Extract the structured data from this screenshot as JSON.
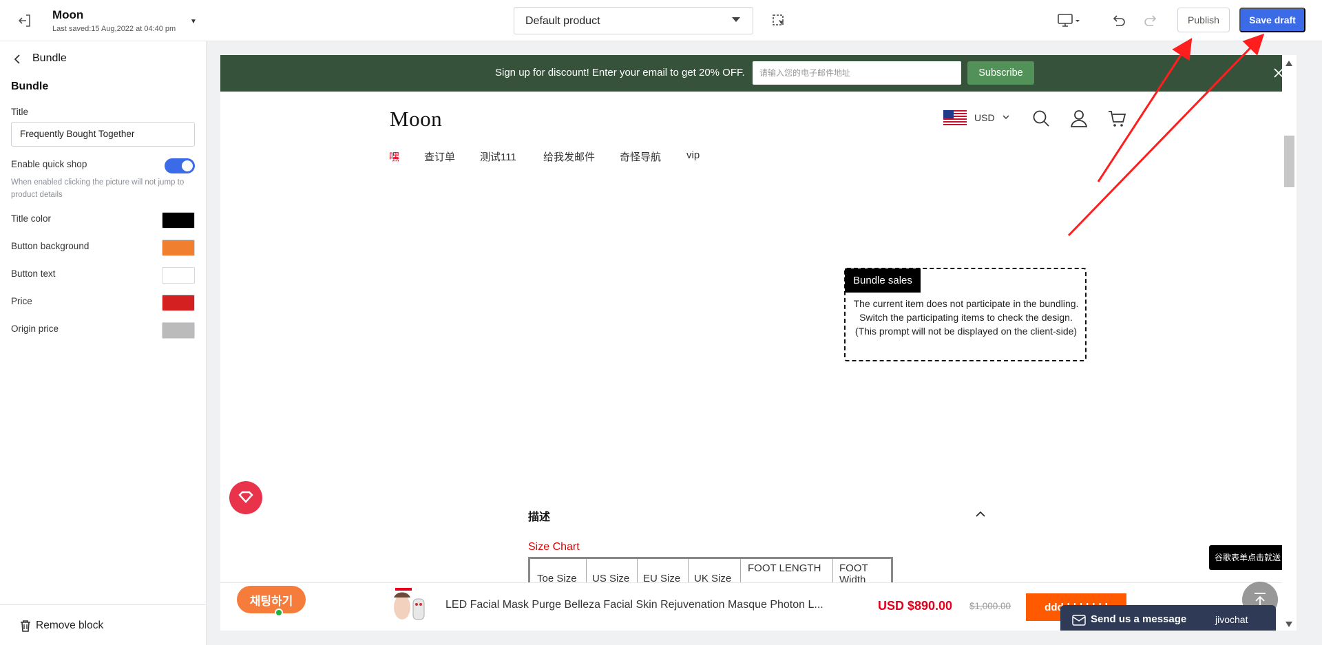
{
  "topbar": {
    "store_name": "Moon",
    "last_saved": "Last saved:15 Aug,2022 at 04:40 pm",
    "template_select": "Default product",
    "publish_label": "Publish",
    "save_label": "Save draft"
  },
  "sidebar": {
    "back_label": "Bundle",
    "section_title": "Bundle",
    "title_label": "Title",
    "title_value": "Frequently Bought Together",
    "quick_shop_label": "Enable quick shop",
    "quick_shop_enabled": true,
    "quick_shop_hint": "When enabled clicking the picture will not jump to product details",
    "colors": [
      {
        "label": "Title color",
        "value": "#000000"
      },
      {
        "label": "Button background",
        "value": "#f08030"
      },
      {
        "label": "Button text",
        "value": "#ffffff"
      },
      {
        "label": "Price",
        "value": "#d42020"
      },
      {
        "label": "Origin price",
        "value": "#bbbbbb"
      }
    ],
    "remove_label": "Remove block"
  },
  "preview": {
    "promo_text": "Sign up for discount! Enter your email to get 20% OFF.",
    "email_placeholder": "请输入您的电子邮件地址",
    "subscribe_label": "Subscribe",
    "logo": "Moon",
    "currency": "USD",
    "nav": [
      "嘿",
      "查订单",
      "测试111",
      "给我发邮件",
      "奇怪导航",
      "vip"
    ],
    "bundle_tag": "Bundle sales",
    "bundle_message": "The current item does not participate in the bundling. Switch the participating items to check the design.(This prompt will not be displayed on the client-side)",
    "description_title": "描述",
    "size_chart_title": "Size Chart",
    "size_table_headers": [
      "Toe Size",
      "US Size",
      "EU Size",
      "UK Size",
      "FOOT LENGTH",
      "FOOT Width"
    ],
    "korean_chat": "채팅하기",
    "google_form": "谷歌表单点击就送",
    "product_name": "LED Facial Mask Purge Belleza Facial Skin Rejuvenation Masque Photon L...",
    "price": "USD  $890.00",
    "origin_price": "$1,000.00",
    "add_button": "dddddddddd",
    "jivo_text": "Send us a message",
    "jivo_brand": "jivochat"
  },
  "colors": {
    "accent": "#3c6be8",
    "promo_bg": "#36523a",
    "subscribe_bg": "#529158",
    "price": "#e3001b",
    "annotation_arrow": "#ff1e1e"
  }
}
